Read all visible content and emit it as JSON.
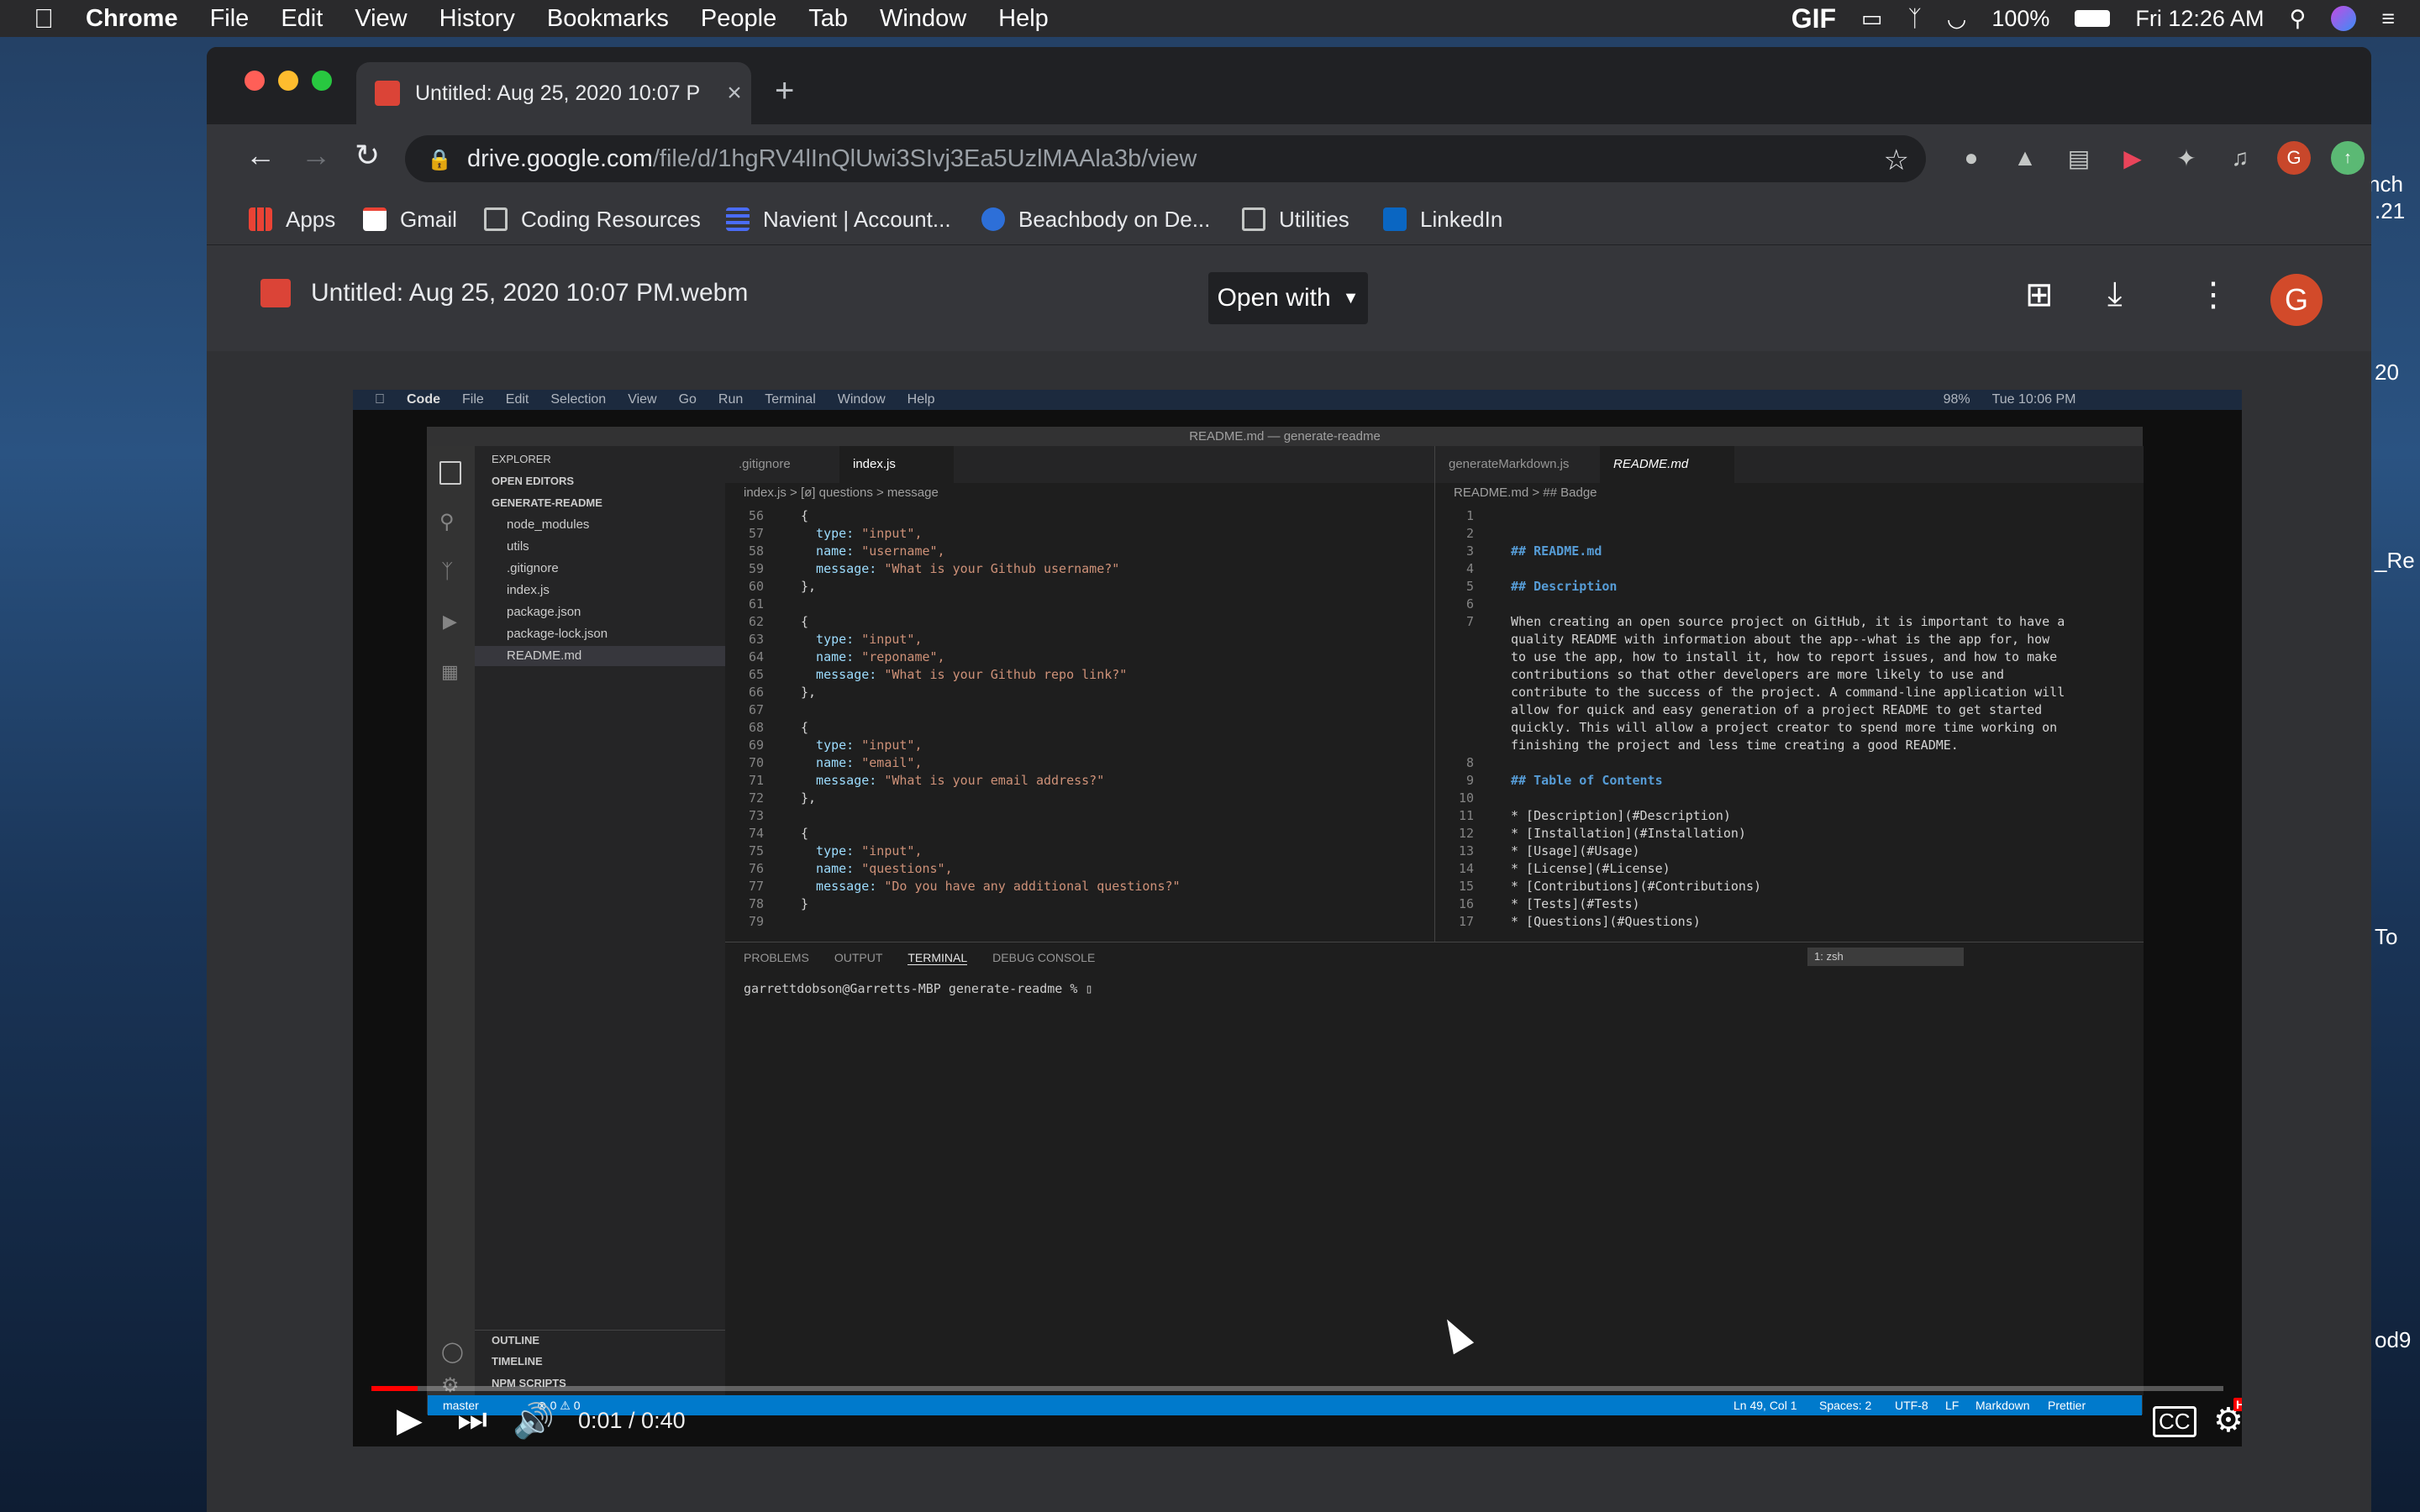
{
  "menubar": {
    "items": [
      "Chrome",
      "File",
      "Edit",
      "View",
      "History",
      "Bookmarks",
      "People",
      "Tab",
      "Window",
      "Help"
    ],
    "status": {
      "gif": "GIF",
      "battery": "100%",
      "clock": "Fri 12:26 AM"
    }
  },
  "desktop": {
    "right_text": [
      "nch",
      ".21",
      "20",
      "_Re",
      "To",
      "od9"
    ]
  },
  "tab": {
    "title": "Untitled: Aug 25, 2020 10:07 P",
    "new_tab_icon": "plus-icon"
  },
  "omnibox": {
    "host": "drive.google.com",
    "path": "/file/d/1hgRV4lInQlUwi3SIvj3Ea5UzlMAAla3b/view"
  },
  "bookmarks": [
    "Apps",
    "Gmail",
    "Coding Resources",
    "Navient | Account...",
    "Beachbody on De...",
    "Utilities",
    "LinkedIn"
  ],
  "profile_initial": "G",
  "viewer": {
    "filename": "Untitled: Aug 25, 2020 10:07 PM.webm",
    "open_with": "Open with",
    "avatar": "G"
  },
  "video": {
    "mac_menu": [
      "Code",
      "File",
      "Edit",
      "Selection",
      "View",
      "Go",
      "Run",
      "Terminal",
      "Window",
      "Help"
    ],
    "mac_clock": "Tue 10:06 PM",
    "mac_battery": "98%",
    "window_title": "README.md — generate-readme",
    "explorer": {
      "title": "EXPLORER",
      "open_editors": "OPEN EDITORS",
      "project": "GENERATE-README",
      "files": [
        "node_modules",
        "utils",
        ".gitignore",
        "index.js",
        "package.json",
        "package-lock.json",
        "README.md"
      ],
      "outline": "OUTLINE",
      "timeline": "TIMELINE",
      "npm": "NPM SCRIPTS"
    },
    "left_tabs": [
      ".gitignore",
      "index.js"
    ],
    "left_crumb": "index.js > [ø] questions > message",
    "left_code": [
      {
        "n": "56",
        "t": "{"
      },
      {
        "n": "57",
        "k": "type: ",
        "s": "\"input\","
      },
      {
        "n": "58",
        "k": "name: ",
        "s": "\"username\","
      },
      {
        "n": "59",
        "k": "message: ",
        "s": "\"What is your Github username?\""
      },
      {
        "n": "60",
        "t": "},"
      },
      {
        "n": "61",
        "t": ""
      },
      {
        "n": "62",
        "t": "{"
      },
      {
        "n": "63",
        "k": "type: ",
        "s": "\"input\","
      },
      {
        "n": "64",
        "k": "name: ",
        "s": "\"reponame\","
      },
      {
        "n": "65",
        "k": "message: ",
        "s": "\"What is your Github repo link?\""
      },
      {
        "n": "66",
        "t": "},"
      },
      {
        "n": "67",
        "t": ""
      },
      {
        "n": "68",
        "t": "{"
      },
      {
        "n": "69",
        "k": "type: ",
        "s": "\"input\","
      },
      {
        "n": "70",
        "k": "name: ",
        "s": "\"email\","
      },
      {
        "n": "71",
        "k": "message: ",
        "s": "\"What is your email address?\""
      },
      {
        "n": "72",
        "t": "},"
      },
      {
        "n": "73",
        "t": ""
      },
      {
        "n": "74",
        "t": "{"
      },
      {
        "n": "75",
        "k": "type: ",
        "s": "\"input\","
      },
      {
        "n": "76",
        "k": "name: ",
        "s": "\"questions\","
      },
      {
        "n": "77",
        "k": "message: ",
        "s": "\"Do you have any additional questions?\""
      },
      {
        "n": "78",
        "t": "}"
      },
      {
        "n": "79",
        "t": ""
      }
    ],
    "right_tabs": [
      "generateMarkdown.js",
      "README.md"
    ],
    "right_crumb": "README.md > ## Badge",
    "right_code": [
      {
        "n": "1",
        "t": ""
      },
      {
        "n": "2",
        "t": ""
      },
      {
        "n": "3",
        "h": "## README.md"
      },
      {
        "n": "4",
        "t": ""
      },
      {
        "n": "5",
        "h": "## Description"
      },
      {
        "n": "6",
        "t": ""
      },
      {
        "n": "7",
        "t": "When creating an open source project on GitHub, it is important to have a"
      },
      {
        "n": "",
        "t": "quality README with information about the app--what is the app for, how"
      },
      {
        "n": "",
        "t": "to use the app, how to install it, how to report issues, and how to make"
      },
      {
        "n": "",
        "t": "contributions so that other developers are more likely to use and"
      },
      {
        "n": "",
        "t": "contribute to the success of the project. A command-line application will"
      },
      {
        "n": "",
        "t": "allow for quick and easy generation of a project README to get started"
      },
      {
        "n": "",
        "t": "quickly. This will allow a project creator to spend more time working on"
      },
      {
        "n": "",
        "t": "finishing the project and less time creating a good README."
      },
      {
        "n": "8",
        "t": ""
      },
      {
        "n": "9",
        "h": "## Table of Contents"
      },
      {
        "n": "10",
        "t": ""
      },
      {
        "n": "11",
        "t": "* [Description](#Description)"
      },
      {
        "n": "12",
        "t": "* [Installation](#Installation)"
      },
      {
        "n": "13",
        "t": "* [Usage](#Usage)"
      },
      {
        "n": "14",
        "t": "* [License](#License)"
      },
      {
        "n": "15",
        "t": "* [Contributions](#Contributions)"
      },
      {
        "n": "16",
        "t": "* [Tests](#Tests)"
      },
      {
        "n": "17",
        "t": "* [Questions](#Questions)"
      }
    ],
    "panel_tabs": [
      "PROBLEMS",
      "OUTPUT",
      "TERMINAL",
      "DEBUG CONSOLE"
    ],
    "terminal_select": "1: zsh",
    "terminal_prompt": "garrettdobson@Garretts-MBP generate-readme % ▯",
    "status_left": "master",
    "status_errors": "⊗ 0 ⚠ 0",
    "status_right": [
      "Ln 49, Col 1",
      "Spaces: 2",
      "UTF-8",
      "LF",
      "Markdown",
      "Prettier"
    ]
  },
  "player": {
    "time": "0:01 / 0:40",
    "progress": 0.025,
    "hd_badge": "HD"
  }
}
